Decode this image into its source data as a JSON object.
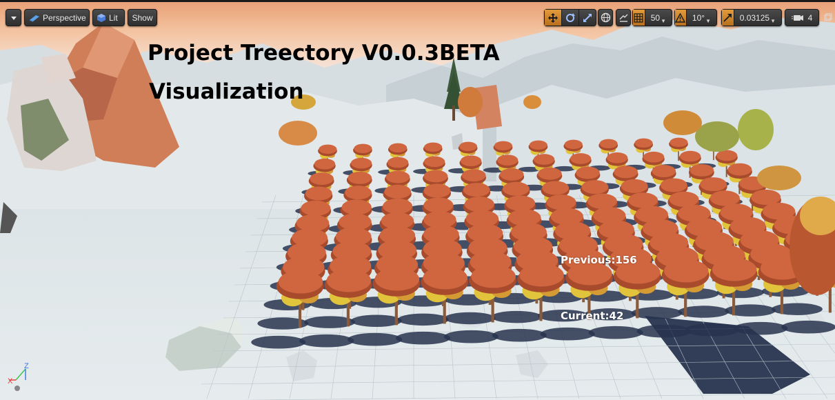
{
  "toolbar": {
    "menu_label": "",
    "perspective_label": "Perspective",
    "lit_label": "Lit",
    "show_label": "Show",
    "grid_snap_value": "50",
    "rotation_snap_value": "10°",
    "scale_snap_value": "0.03125",
    "camera_speed_value": "4"
  },
  "overlay": {
    "title": "Project Treectory V0.0.3BETA",
    "subtitle": "Visualization"
  },
  "hud": {
    "previous": "Previous:156",
    "current": "Current:42"
  },
  "axis": {
    "x": "X",
    "z": "Z"
  },
  "colors": {
    "accent": "#e0942f",
    "sky_top": "#efae83",
    "tree_canopy": "#d0663f",
    "tree_canopy_dark": "#a84a2c",
    "tree_yellow": "#e2c43c",
    "ground": "#dfe6e8",
    "shadow": "#28344f"
  },
  "icons": [
    "dropdown-icon",
    "perspective-icon",
    "lit-sphere-icon",
    "translate-icon",
    "rotate-icon",
    "scale-icon",
    "world-local-icon",
    "surface-snap-icon",
    "grid-icon",
    "rotation-snap-icon",
    "scale-snap-icon",
    "camera-speed-icon",
    "maximize-icon"
  ]
}
